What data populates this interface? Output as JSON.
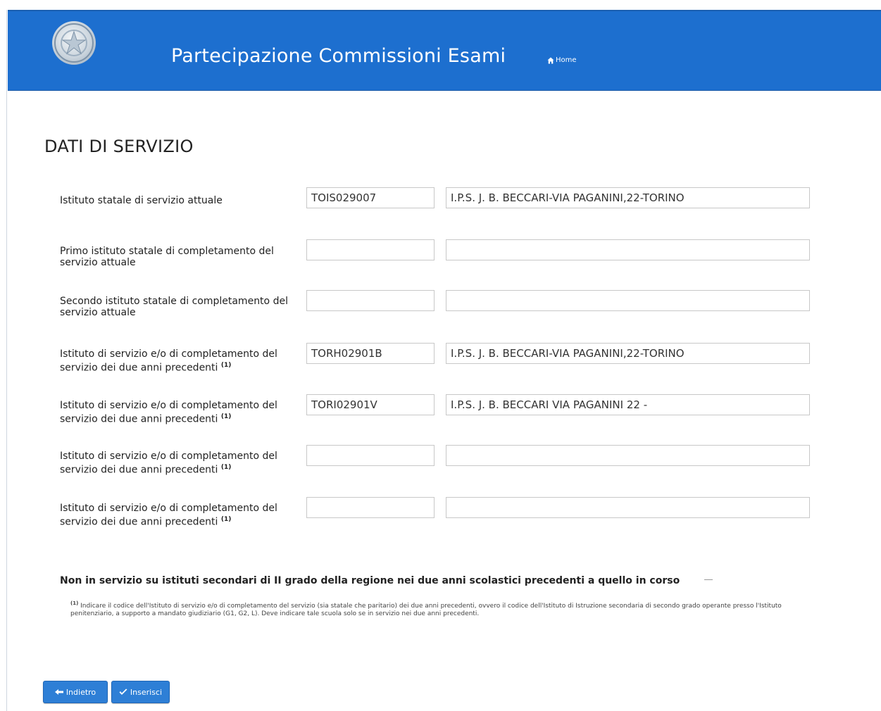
{
  "header": {
    "app_title": "Partecipazione Commissioni Esami",
    "home_label": "Home",
    "logo_icon": "emblem-icon",
    "bg_color": "#1d6fcf"
  },
  "section": {
    "title": "DATI DI SERVIZIO"
  },
  "rows": [
    {
      "label": "Istituto statale di servizio attuale",
      "footnote_mark": "",
      "code": "TOIS029007",
      "name": "I.P.S. J. B. BECCARI-VIA PAGANINI,22-TORINO"
    },
    {
      "label": "Primo istituto statale di completamento del servizio attuale",
      "footnote_mark": "",
      "code": "",
      "name": ""
    },
    {
      "label": "Secondo istituto statale di completamento del servizio attuale",
      "footnote_mark": "",
      "code": "",
      "name": ""
    },
    {
      "label": "Istituto di servizio e/o di completamento del servizio dei due anni precedenti",
      "footnote_mark": "(1)",
      "code": "TORH02901B",
      "name": "I.P.S. J. B. BECCARI-VIA PAGANINI,22-TORINO"
    },
    {
      "label": "Istituto di servizio e/o di completamento del servizio dei due anni precedenti",
      "footnote_mark": "(1)",
      "code": "TORI02901V",
      "name": "I.P.S. J. B. BECCARI VIA PAGANINI 22 -"
    },
    {
      "label": "Istituto di servizio e/o di completamento del servizio dei due anni precedenti",
      "footnote_mark": "(1)",
      "code": "",
      "name": ""
    },
    {
      "label": "Istituto di servizio e/o di completamento del servizio dei due anni precedenti",
      "footnote_mark": "(1)",
      "code": "",
      "name": ""
    }
  ],
  "checkline": "Non in servizio su istituti secondari di II grado della regione nei due anni scolastici precedenti a quello in corso",
  "footnote": {
    "mark": "(1)",
    "text": "Indicare il codice dell'Istituto di servizio e/o di completamento del servizio (sia statale che paritario) dei due anni precedenti, ovvero il codice dell'Istituto di Istruzione secondaria di secondo grado operante presso l'Istituto penitenziario, a supporto a mandato giudiziario (G1, G2, L). Deve indicare tale scuola solo se in servizio nei due anni precedenti."
  },
  "buttons": {
    "back_label": "Indietro",
    "confirm_label": "Inserisci",
    "color": "#2e7fd6"
  }
}
